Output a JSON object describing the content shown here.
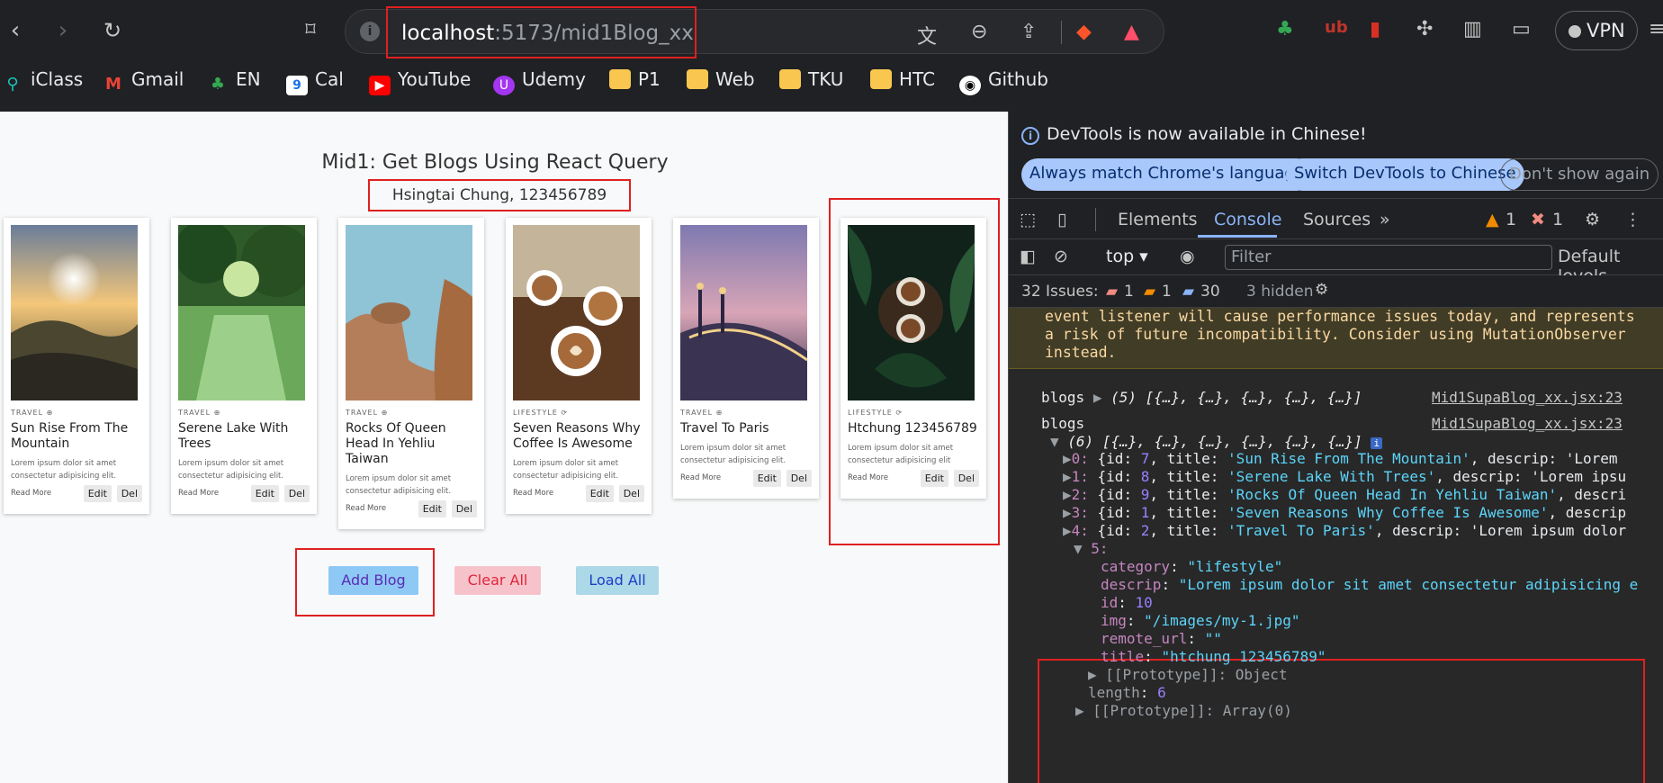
{
  "browser": {
    "url_host": "localhost",
    "url_path": ":5173/mid1Blog_xx",
    "vpn_label": "VPN",
    "bookmarks": [
      "iClass",
      "Gmail",
      "EN",
      "Cal",
      "YouTube",
      "Udemy",
      "P1",
      "Web",
      "TKU",
      "HTC",
      "Github"
    ]
  },
  "page": {
    "title": "Mid1: Get Blogs Using React Query",
    "name": "Hsingtai Chung, 123456789",
    "cards": [
      {
        "category": "TRAVEL ⊕",
        "title": "Sun Rise From The Mountain",
        "desc": "Lorem ipsum dolor sit amet consectetur adipisicing elit.",
        "read": "Read More",
        "edit": "Edit",
        "del": "Del"
      },
      {
        "category": "TRAVEL ⊕",
        "title": "Serene Lake With Trees",
        "desc": "Lorem ipsum dolor sit amet consectetur adipisicing elit.",
        "read": "Read More",
        "edit": "Edit",
        "del": "Del"
      },
      {
        "category": "TRAVEL ⊕",
        "title": "Rocks Of Queen Head In Yehliu Taiwan",
        "desc": "Lorem ipsum dolor sit amet consectetur adipisicing elit.",
        "read": "Read More",
        "edit": "Edit",
        "del": "Del"
      },
      {
        "category": "LIFESTYLE ⟳",
        "title": "Seven Reasons Why Coffee Is Awesome",
        "desc": "Lorem ipsum dolor sit amet consectetur adipisicing elit.",
        "read": "Read More",
        "edit": "Edit",
        "del": "Del"
      },
      {
        "category": "TRAVEL ⊕",
        "title": "Travel To Paris",
        "desc": "Lorem ipsum dolor sit amet consectetur adipisicing elit.",
        "read": "Read More",
        "edit": "Edit",
        "del": "Del"
      },
      {
        "category": "LIFESTYLE ⟳",
        "title": "Htchung 123456789",
        "desc": "Lorem ipsum dolor sit amet consectetur adipisicing elit",
        "read": "Read More",
        "edit": "Edit",
        "del": "Del"
      }
    ],
    "buttons": {
      "add": "Add Blog",
      "clear": "Clear All",
      "load": "Load All"
    }
  },
  "devtools": {
    "notice": "DevTools is now available in Chinese!",
    "pill1": "Always match Chrome's language",
    "pill2": "Switch DevTools to Chinese",
    "pill3": "Don't show again",
    "tabs": [
      "Elements",
      "Console",
      "Sources"
    ],
    "warn_count": "1",
    "err_count": "1",
    "context": "top",
    "filter_placeholder": "Filter",
    "levels": "Default levels",
    "issues_label": "32 Issues:",
    "issues_err": "1",
    "issues_warn": "1",
    "issues_info": "30",
    "hidden": "3 hidden",
    "warning_text": "event listener will cause performance issues today, and represents\na risk of future incompatibility. Consider using MutationObserver\ninstead.",
    "log1_label": "blogs",
    "log1_value": "(5) [{…}, {…}, {…}, {…}, {…}]",
    "log1_src": "Mid1SupaBlog_xx.jsx:23",
    "log2_label": "blogs",
    "log2_value": "(6) [{…}, {…}, {…}, {…}, {…}, {…}]",
    "log2_src": "Mid1SupaBlog_xx.jsx:23",
    "rows": [
      {
        "idx": "0:",
        "id": "7",
        "title": "'Sun Rise From The Mountain'",
        "tail": "descrip: 'Lorem"
      },
      {
        "idx": "1:",
        "id": "8",
        "title": "'Serene Lake With Trees'",
        "tail": "descrip: 'Lorem ipsu"
      },
      {
        "idx": "2:",
        "id": "9",
        "title": "'Rocks Of Queen Head In Yehliu Taiwan'",
        "tail": "descri"
      },
      {
        "idx": "3:",
        "id": "1",
        "title": "'Seven Reasons Why Coffee Is Awesome'",
        "tail": "descrip"
      },
      {
        "idx": "4:",
        "id": "2",
        "title": "'Travel To Paris'",
        "tail": "descrip: 'Lorem ipsum dolor"
      }
    ],
    "obj5": {
      "idx": "5:",
      "category": "\"lifestyle\"",
      "descrip": "\"Lorem ipsum dolor sit amet consectetur adipisicing e",
      "id": "10",
      "img": "\"/images/my-1.jpg\"",
      "remote_url": "\"\"",
      "title": "\"htchung 123456789\""
    },
    "proto_obj": "[[Prototype]]: Object",
    "length": "6",
    "proto_arr": "[[Prototype]]: Array(0)"
  }
}
